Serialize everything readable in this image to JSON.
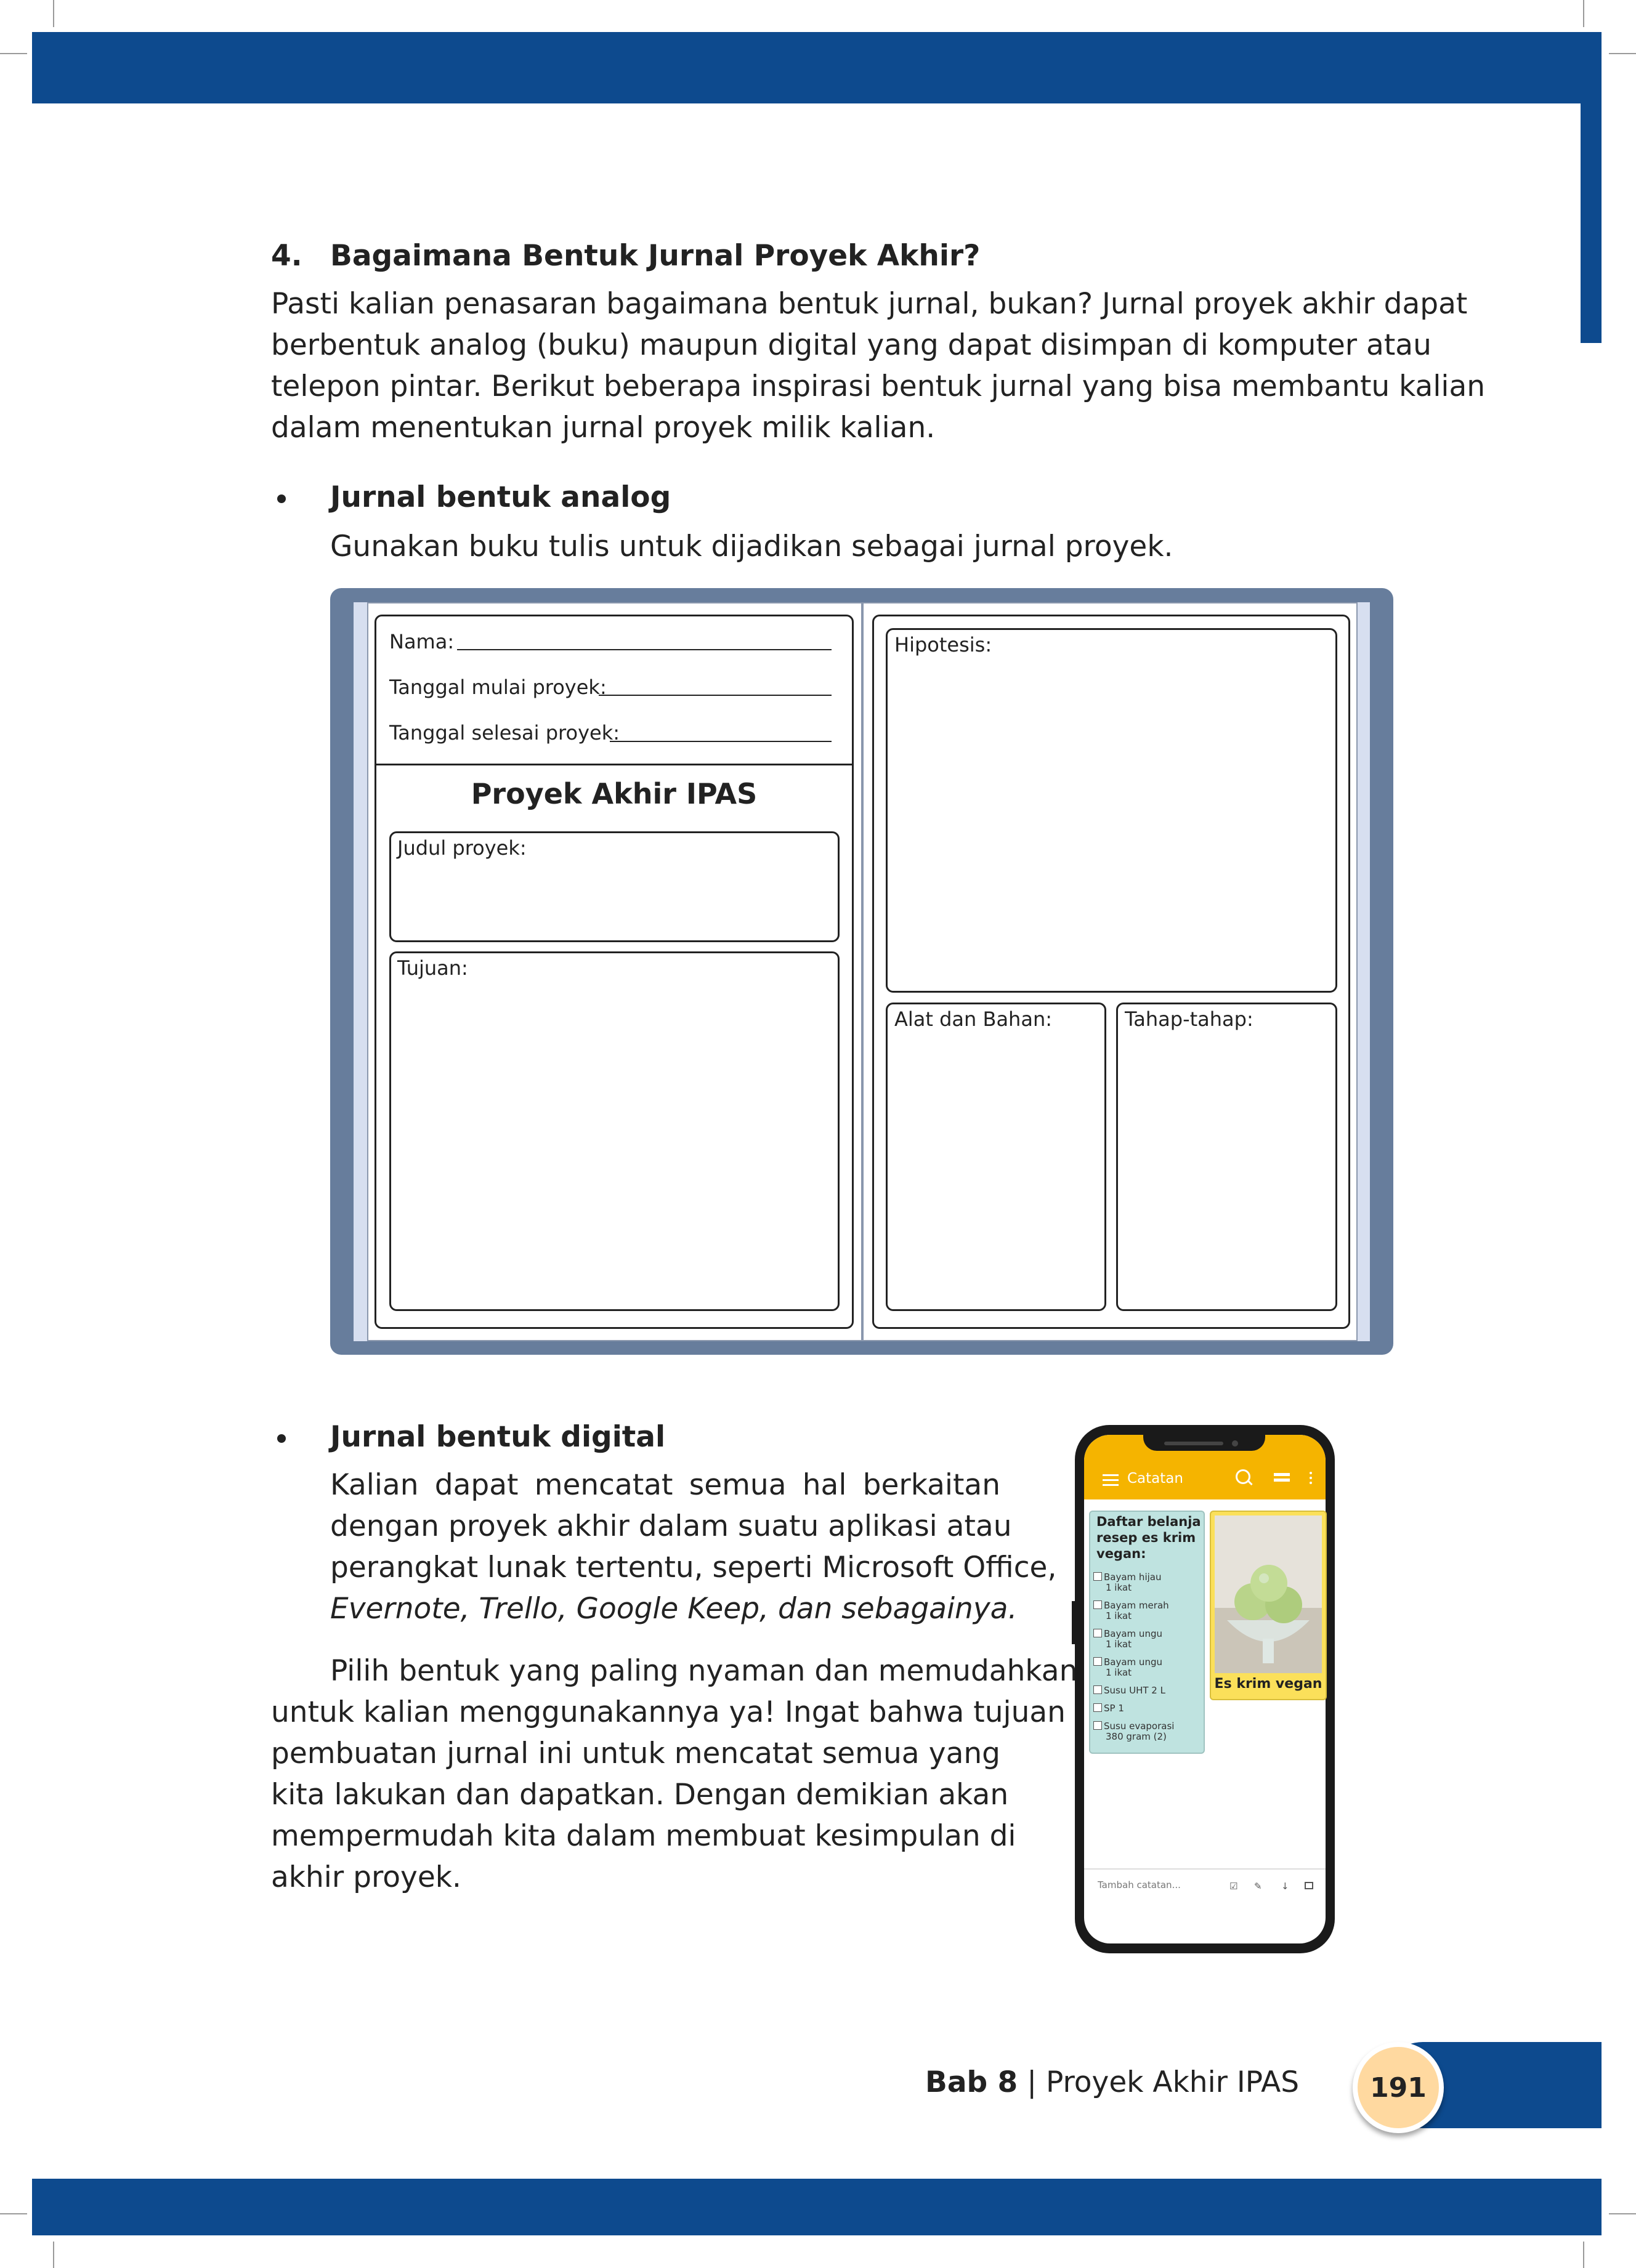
{
  "section": {
    "number": "4.",
    "title": "Bagaimana Bentuk Jurnal Proyek Akhir?",
    "intro_lines": [
      "Pasti kalian penasaran bagaimana bentuk jurnal, bukan? Jurnal proyek akhir dapat",
      "berbentuk analog (buku) maupun digital yang dapat disimpan di komputer atau",
      "telepon pintar. Berikut beberapa inspirasi bentuk jurnal yang bisa membantu kalian",
      "dalam menentukan jurnal proyek milik kalian."
    ]
  },
  "analog": {
    "title": "Jurnal bentuk analog",
    "text": "Gunakan buku tulis untuk dijadikan sebagai jurnal proyek."
  },
  "journal": {
    "name_label": "Nama:",
    "start_label": "Tanggal mulai proyek:",
    "end_label": "Tanggal selesai proyek:",
    "title": "Proyek Akhir IPAS",
    "project_title_label": "Judul proyek:",
    "goal_label": "Tujuan:",
    "hypothesis_label": "Hipotesis:",
    "tools_label": "Alat dan Bahan:",
    "steps_label": "Tahap-tahap:"
  },
  "digital": {
    "title": "Jurnal bentuk digital",
    "para1_lines": [
      "Kalian dapat mencatat semua hal berkaitan",
      "dengan proyek akhir dalam suatu aplikasi atau",
      "perangkat lunak tertentu, seperti Microsoft Office,",
      "Evernote, Trello, Google Keep, dan sebagainya."
    ],
    "para2_lines": [
      "Pilih bentuk yang paling nyaman dan memudahkan",
      "untuk kalian menggunakannya ya! Ingat bahwa tujuan",
      "pembuatan jurnal ini untuk mencatat semua yang",
      "kita lakukan dan dapatkan. Dengan demikian akan",
      "mempermudah kita dalam membuat kesimpulan di",
      "akhir proyek."
    ]
  },
  "phone": {
    "app_title": "Catatan",
    "note_title": "Daftar belanja resep es krim vegan:",
    "items": [
      [
        "Bayam hijau",
        "1 ikat"
      ],
      [
        "Bayam merah",
        "1 ikat"
      ],
      [
        "Bayam ungu",
        "1 ikat"
      ],
      [
        "Bayam ungu",
        "1 ikat"
      ],
      [
        "Susu UHT 2 L",
        ""
      ],
      [
        "SP 1",
        ""
      ],
      [
        "Susu evaporasi",
        "380 gram (2)"
      ]
    ],
    "image_caption": "Es krim vegan",
    "add_note_placeholder": "Tambah catatan...",
    "colors": {
      "app_bar": "#f5b400",
      "note_card": "#bfe3e0",
      "image_card": "#fbe05a"
    }
  },
  "footer": {
    "chapter": "Bab 8",
    "separator": " | ",
    "chapter_title": "Proyek Akhir IPAS",
    "page_number": "191"
  },
  "colors": {
    "brand_blue": "#0d4a8e",
    "book_cover": "#677d9c",
    "page_badge": "#ffd9a0"
  }
}
